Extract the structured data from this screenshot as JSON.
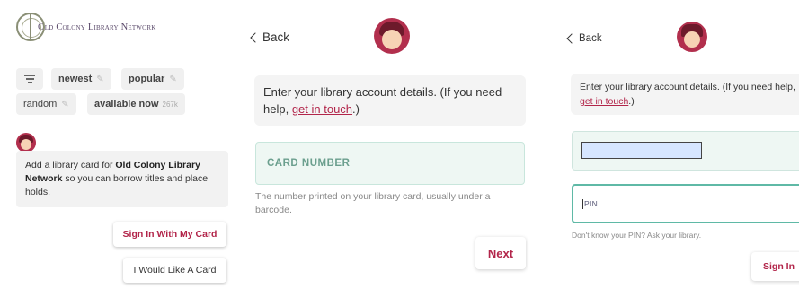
{
  "panel1": {
    "logo_text": "Old Colony Library Network",
    "chips": {
      "newest": "newest",
      "popular": "popular",
      "random": "random",
      "available": "available now",
      "available_count": "267k"
    },
    "message_lead": "Add a library card for ",
    "message_library": "Old Colony Library Network",
    "message_tail": " so you can borrow titles and place holds.",
    "sign_in_button": "Sign In With My Card",
    "want_card_button": "I Would Like A Card"
  },
  "panel2": {
    "back_label": "Back",
    "prompt_lead": "Enter your library account details. (If you need help, ",
    "prompt_link": "get in touch",
    "prompt_tail": ".)",
    "card_placeholder": "CARD NUMBER",
    "card_help": "The number printed on your library card, usually under a barcode.",
    "next_button": "Next"
  },
  "panel3": {
    "back_label": "Back",
    "prompt_lead": "Enter your library account details. (If you need help, ",
    "prompt_link": "get in touch",
    "prompt_tail": ".)",
    "pin_placeholder": "PIN",
    "pin_help": "Don't know your PIN? Ask your library.",
    "sign_in_button": "Sign In"
  },
  "colors": {
    "accent": "#b2254a",
    "field_bg": "#eef7f3",
    "focus_border": "#5fb9a6"
  },
  "icons": [
    "filter-icon",
    "edit-icon",
    "back-chevron-icon",
    "avatar-icon",
    "library-logo-icon"
  ]
}
